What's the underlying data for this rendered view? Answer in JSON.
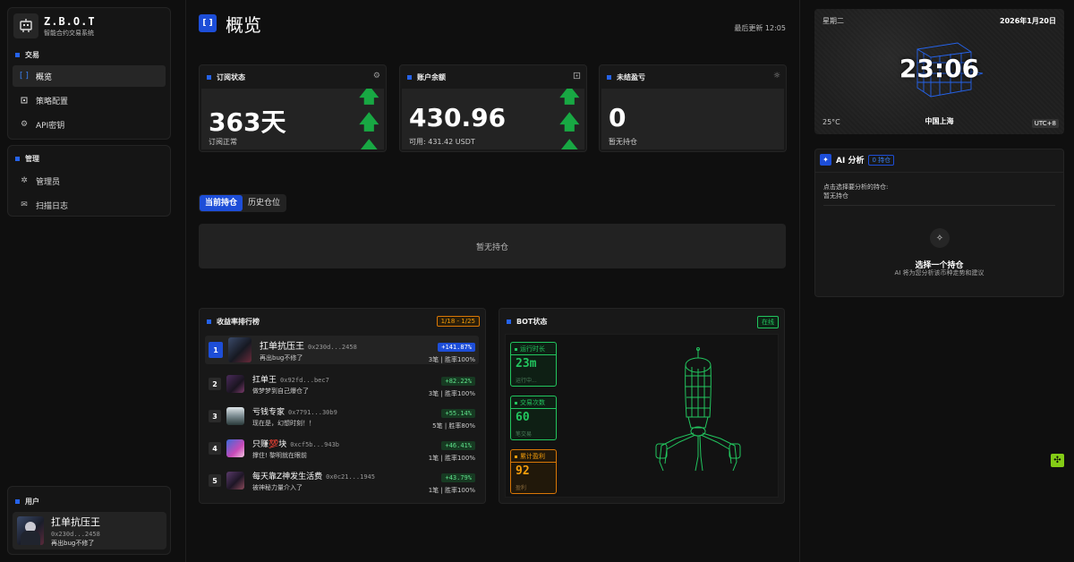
{
  "brand": {
    "name": "Z.B.O.T",
    "subtitle": "智能合约交易系统"
  },
  "nav": {
    "trade_section": "交易",
    "trade_items": [
      {
        "label": "概览",
        "icon": "bracket-icon",
        "active": true
      },
      {
        "label": "策略配置",
        "icon": "chip-icon"
      },
      {
        "label": "API密钥",
        "icon": "gear-icon"
      }
    ],
    "admin_section": "管理",
    "admin_items": [
      {
        "label": "管理员",
        "icon": "admin-icon"
      },
      {
        "label": "扫描日志",
        "icon": "mail-icon"
      }
    ],
    "user_section": "用户"
  },
  "user": {
    "name": "扛单抗压王",
    "address": "0x230d...2458",
    "bio": "再出bug不修了"
  },
  "header": {
    "icon": "[ ]",
    "title": "概览",
    "last_update": "最后更新 12:05"
  },
  "stats": [
    {
      "label": "订阅状态",
      "value": "363天",
      "sub": "订阅正常",
      "icon": "gear-icon"
    },
    {
      "label": "账户余额",
      "value": "430.96",
      "sub": "可用: 431.42 USDT",
      "icon": "chip-icon"
    },
    {
      "label": "未结盈亏",
      "value": "0",
      "sub": "暂无持仓",
      "icon": "sun-icon"
    }
  ],
  "tabs": {
    "current": "当前持仓",
    "history": "历史仓位"
  },
  "positions": {
    "empty": "暂无持仓"
  },
  "leaderboard": {
    "title": "收益率排行榜",
    "range": "1/18 - 1/25",
    "rows": [
      {
        "rank": "1",
        "name": "扛单抗压王",
        "address": "0x230d...2458",
        "bio": "再出bug不修了",
        "pct": "+141.87%",
        "stat": "3笔 | 胜率100%"
      },
      {
        "rank": "2",
        "name": "扛单王",
        "address": "0x92fd...bec7",
        "bio": "做梦梦到自己爆仓了",
        "pct": "+82.22%",
        "stat": "3笔 | 胜率100%"
      },
      {
        "rank": "3",
        "name": "亏钱专家",
        "address": "0x7791...30b9",
        "bio": "现在是，幻想时刻！！",
        "pct": "+55.14%",
        "stat": "5笔 | 胜率80%"
      },
      {
        "rank": "4",
        "name": "只赚💯块",
        "address": "0xcf5b...943b",
        "bio": "撑住! 黎明就在眼前",
        "pct": "+46.41%",
        "stat": "1笔 | 胜率100%"
      },
      {
        "rank": "5",
        "name": "每天靠Z神发生活费",
        "address": "0x0c21...1945",
        "bio": "被神秘力量介入了",
        "pct": "+43.79%",
        "stat": "1笔 | 胜率100%"
      }
    ]
  },
  "bot": {
    "title": "BOT状态",
    "status": "在线",
    "metrics": [
      {
        "label": "运行时长",
        "value": "23m",
        "sub": "运行中..."
      },
      {
        "label": "交易次数",
        "value": "60",
        "sub": "笔交易"
      },
      {
        "label": "累计盈利",
        "value": "92",
        "sub": "盈利"
      }
    ]
  },
  "clock": {
    "day": "星期二",
    "date": "2026年1月20日",
    "time": "23:06",
    "temp": "25°C",
    "city": "中国上海",
    "tz": "UTC+8"
  },
  "ai": {
    "title": "AI 分析",
    "count": "0 持仓",
    "prompt": "点击选择要分析的持仓:",
    "none": "暂无持仓",
    "empty_title": "选择一个持仓",
    "empty_sub": "AI 将为您分析该币种走势和建议"
  },
  "colors": {
    "accent": "#1d4ed8",
    "positive": "#22c55e",
    "warning": "#f59e0b",
    "float_button": "#84cc16"
  }
}
